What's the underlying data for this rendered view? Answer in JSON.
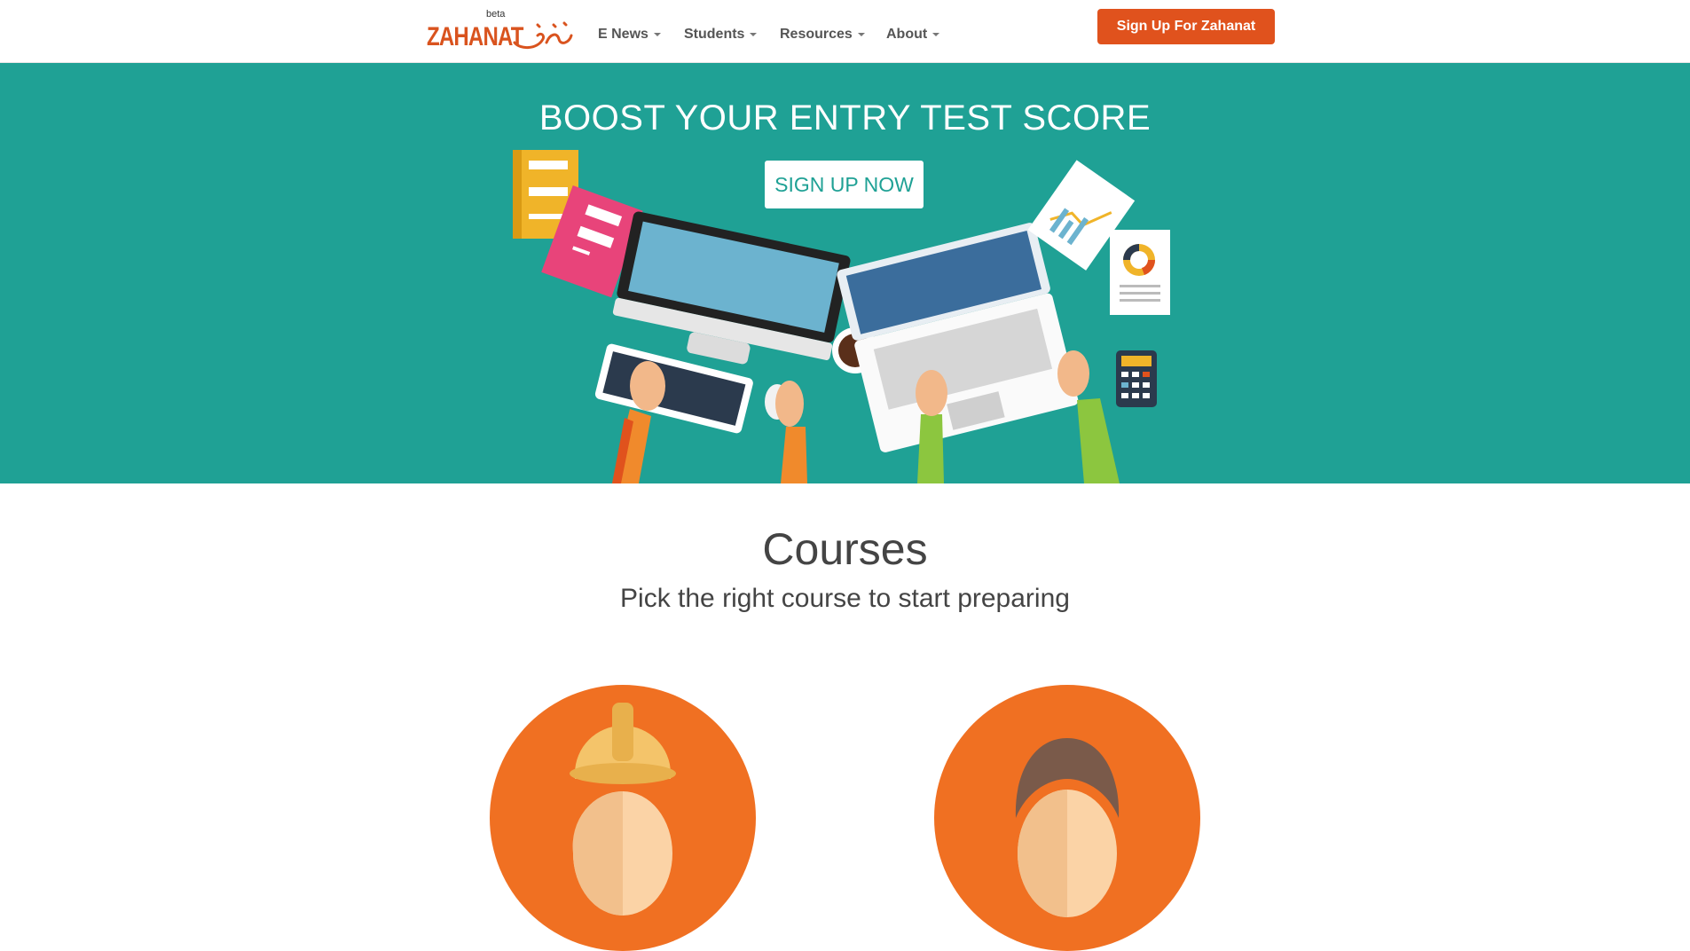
{
  "brand": {
    "beta": "beta",
    "name": "ZAHANAT"
  },
  "nav": [
    {
      "label": "E News"
    },
    {
      "label": "Students"
    },
    {
      "label": "Resources"
    },
    {
      "label": "About"
    }
  ],
  "header": {
    "signup_label": "Sign Up For Zahanat"
  },
  "hero": {
    "title": "BOOST YOUR ENTRY TEST SCORE",
    "button_label": "SIGN UP NOW"
  },
  "courses": {
    "title": "Courses",
    "subtitle": "Pick the right course to start preparing"
  },
  "colors": {
    "brand": "#e0521d",
    "hero_bg": "#1fa195",
    "course_bg": "#f07022",
    "text": "#444444"
  },
  "icons": [
    "caret-down-icon",
    "engineer-hardhat-icon",
    "doctor-avatar-icon"
  ]
}
